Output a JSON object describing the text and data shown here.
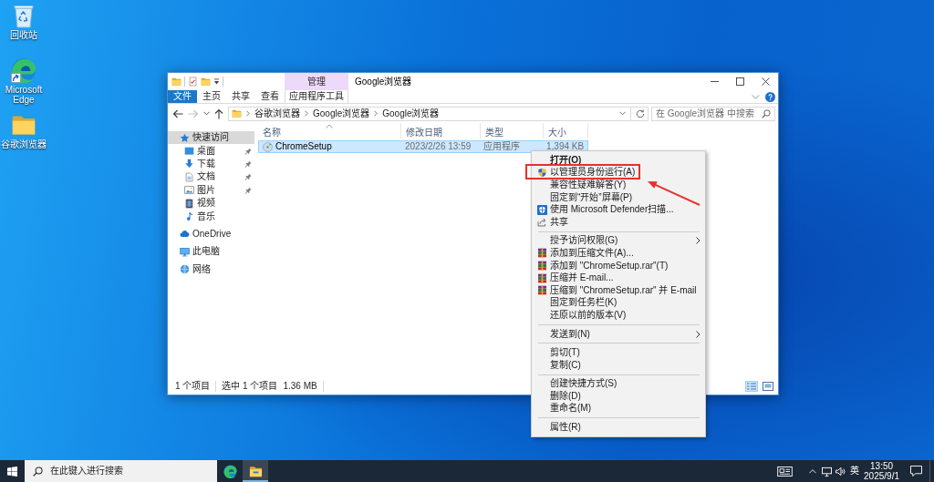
{
  "desktop_icons": [
    {
      "kind": "recycle-bin",
      "label": "回收站",
      "shortcut": false
    },
    {
      "kind": "edge",
      "label": "Microsoft Edge",
      "shortcut": true
    },
    {
      "kind": "folder",
      "label": "谷歌浏览器",
      "shortcut": false
    }
  ],
  "window": {
    "title": "Google浏览器",
    "tab_group": "管理",
    "ribbon_tabs": [
      {
        "kind": "file",
        "label": "文件"
      },
      {
        "kind": "plain",
        "label": "主页"
      },
      {
        "kind": "plain",
        "label": "共享"
      },
      {
        "kind": "plain",
        "label": "查看"
      },
      {
        "kind": "context",
        "label": "应用程序工具"
      }
    ],
    "nav_buttons": [
      {
        "kind": "back",
        "disabled": false
      },
      {
        "kind": "forward",
        "disabled": true
      },
      {
        "kind": "recent",
        "disabled": false
      },
      {
        "kind": "up",
        "disabled": false
      }
    ],
    "address_path": [
      "谷歌浏览器",
      "Google浏览器",
      "Google浏览器"
    ],
    "search": {
      "placeholder": "在 Google浏览器 中搜索"
    },
    "sidebar": {
      "items": [
        {
          "kind": "star",
          "label": "快速访问",
          "selected": true,
          "pinned": false,
          "children": [
            {
              "kind": "desktop",
              "label": "桌面",
              "selected": false,
              "pinned": true
            },
            {
              "kind": "download",
              "label": "下载",
              "selected": false,
              "pinned": true
            },
            {
              "kind": "document",
              "label": "文档",
              "selected": false,
              "pinned": true
            },
            {
              "kind": "picture",
              "label": "图片",
              "selected": false,
              "pinned": true
            },
            {
              "kind": "video",
              "label": "视频",
              "selected": false,
              "pinned": false
            },
            {
              "kind": "music",
              "label": "音乐",
              "selected": false,
              "pinned": false
            }
          ]
        },
        {
          "kind": "cloud",
          "label": "OneDrive",
          "selected": false,
          "pinned": false
        },
        {
          "kind": "computer",
          "label": "此电脑",
          "selected": false,
          "pinned": false
        },
        {
          "kind": "network",
          "label": "网络",
          "selected": false,
          "pinned": false
        }
      ]
    },
    "columns": [
      {
        "label": "名称",
        "sorted": true
      },
      {
        "label": "修改日期",
        "sorted": false
      },
      {
        "label": "类型",
        "sorted": false
      },
      {
        "label": "大小",
        "sorted": false
      }
    ],
    "files": [
      {
        "name": "ChromeSetup",
        "modified": "2023/2/26 13:59",
        "type": "应用程序",
        "size": "1,394 KB",
        "selected": true
      }
    ],
    "status_bar": {
      "item_count": "1 个项目",
      "selection": "选中 1 个项目",
      "selection_size": "1.36 MB"
    },
    "views": [
      {
        "kind": "details",
        "selected": true
      },
      {
        "kind": "large-icons",
        "selected": false
      }
    ]
  },
  "context_menu": {
    "items": [
      {
        "kind": "plain",
        "label": "打开(O)",
        "default": true,
        "submenu": false,
        "annotated": false
      },
      {
        "kind": "shield",
        "label": "以管理员身份运行(A)",
        "default": false,
        "submenu": false,
        "annotated": true
      },
      {
        "kind": "plain",
        "label": "兼容性疑难解答(Y)",
        "default": false,
        "submenu": false,
        "annotated": false
      },
      {
        "kind": "plain",
        "label": "固定到“开始”屏幕(P)",
        "default": false,
        "submenu": false,
        "annotated": false
      },
      {
        "kind": "defender",
        "label": "使用 Microsoft Defender扫描...",
        "default": false,
        "submenu": false,
        "annotated": false
      },
      {
        "kind": "share",
        "label": "共享",
        "default": false,
        "submenu": false,
        "annotated": false
      },
      {
        "kind": "separator"
      },
      {
        "kind": "plain",
        "label": "授予访问权限(G)",
        "default": false,
        "submenu": true,
        "annotated": false
      },
      {
        "kind": "archive",
        "label": "添加到压缩文件(A)...",
        "default": false,
        "submenu": false,
        "annotated": false
      },
      {
        "kind": "archive",
        "label": "添加到 \"ChromeSetup.rar\"(T)",
        "default": false,
        "submenu": false,
        "annotated": false
      },
      {
        "kind": "archive",
        "label": "压缩并 E-mail...",
        "default": false,
        "submenu": false,
        "annotated": false
      },
      {
        "kind": "archive",
        "label": "压缩到 \"ChromeSetup.rar\" 并 E-mail",
        "default": false,
        "submenu": false,
        "annotated": false
      },
      {
        "kind": "plain",
        "label": "固定到任务栏(K)",
        "default": false,
        "submenu": false,
        "annotated": false
      },
      {
        "kind": "plain",
        "label": "还原以前的版本(V)",
        "default": false,
        "submenu": false,
        "annotated": false
      },
      {
        "kind": "separator"
      },
      {
        "kind": "plain",
        "label": "发送到(N)",
        "default": false,
        "submenu": true,
        "annotated": false
      },
      {
        "kind": "separator"
      },
      {
        "kind": "plain",
        "label": "剪切(T)",
        "default": false,
        "submenu": false,
        "annotated": false
      },
      {
        "kind": "plain",
        "label": "复制(C)",
        "default": false,
        "submenu": false,
        "annotated": false
      },
      {
        "kind": "separator"
      },
      {
        "kind": "plain",
        "label": "创建快捷方式(S)",
        "default": false,
        "submenu": false,
        "annotated": false
      },
      {
        "kind": "plain",
        "label": "删除(D)",
        "default": false,
        "submenu": false,
        "annotated": false
      },
      {
        "kind": "plain",
        "label": "重命名(M)",
        "default": false,
        "submenu": false,
        "annotated": false
      },
      {
        "kind": "separator"
      },
      {
        "kind": "plain",
        "label": "属性(R)",
        "default": false,
        "submenu": false,
        "annotated": false
      }
    ]
  },
  "taskbar": {
    "search": {
      "placeholder": "在此键入进行搜索"
    },
    "apps": [
      {
        "kind": "edge",
        "active": false
      },
      {
        "kind": "explorer",
        "active": true
      }
    ],
    "language": "英",
    "time": "13:50",
    "date": "2025/9/1"
  }
}
